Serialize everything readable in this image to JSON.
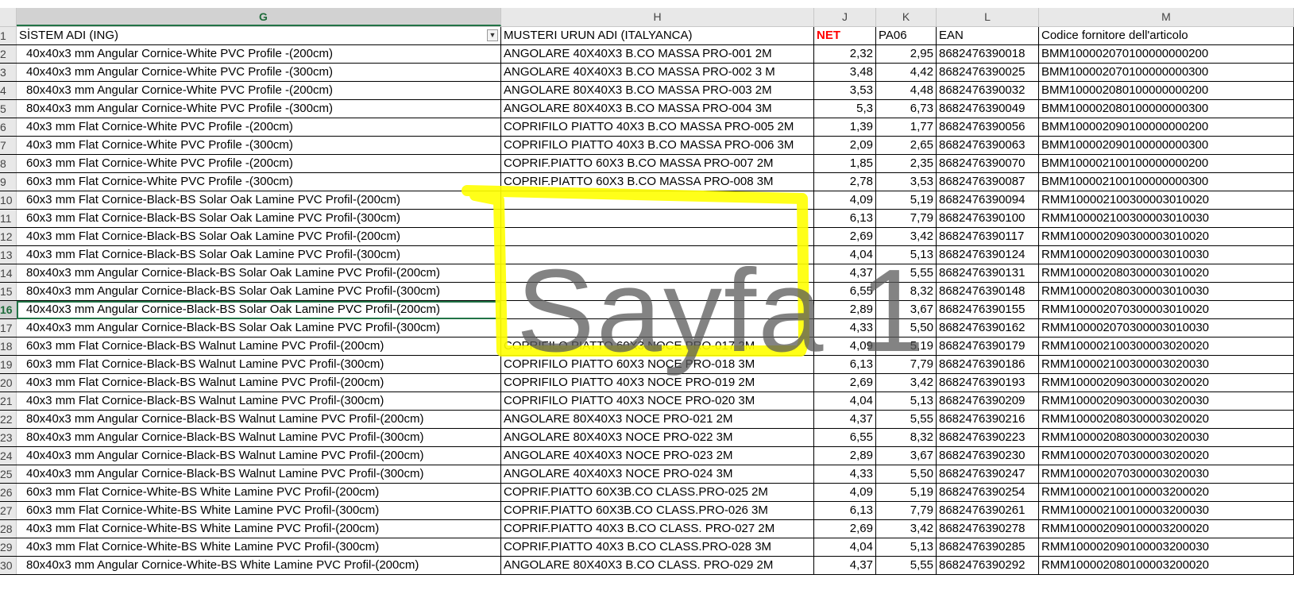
{
  "columns": [
    {
      "letter": "G",
      "selected": true
    },
    {
      "letter": "H",
      "selected": false
    },
    {
      "letter": "J",
      "selected": false
    },
    {
      "letter": "K",
      "selected": false
    },
    {
      "letter": "L",
      "selected": false
    },
    {
      "letter": "M",
      "selected": false
    }
  ],
  "header": {
    "row": "1",
    "g": "SİSTEM ADI (ING)",
    "h": "MUSTERI URUN ADI (ITALYANCA)",
    "j": "NET",
    "k": "PA06",
    "l": "EAN",
    "m": "Codice fornitore dell'articolo"
  },
  "active_row": "16",
  "net_color": "#ff0000",
  "highlight_color": "#ffff00",
  "watermark": "Sayfa 1",
  "rows": [
    {
      "n": "2",
      "g": "40x40x3 mm Angular Cornice-White PVC Profile -(200cm)",
      "h": "ANGOLARE 40X40X3 B.CO MASSA PRO-001 2M",
      "j": "2,32",
      "k": "2,95",
      "l": "8682476390018",
      "m": "BMM100002070100000000200"
    },
    {
      "n": "3",
      "g": "40x40x3 mm Angular Cornice-White PVC Profile -(300cm)",
      "h": "ANGOLARE 40X40X3 B.CO MASSA PRO-002 3 M",
      "j": "3,48",
      "k": "4,42",
      "l": "8682476390025",
      "m": "BMM100002070100000000300"
    },
    {
      "n": "4",
      "g": "80x40x3 mm Angular Cornice-White PVC Profile -(200cm)",
      "h": "ANGOLARE 80X40X3 B.CO MASSA PRO-003 2M",
      "j": "3,53",
      "k": "4,48",
      "l": "8682476390032",
      "m": "BMM100002080100000000200"
    },
    {
      "n": "5",
      "g": "80x40x3 mm Angular Cornice-White PVC Profile -(300cm)",
      "h": "ANGOLARE 80X40X3 B.CO MASSA PRO-004 3M",
      "j": "5,3",
      "k": "6,73",
      "l": "8682476390049",
      "m": "BMM100002080100000000300"
    },
    {
      "n": "6",
      "g": "40x3 mm Flat Cornice-White PVC Profile -(200cm)",
      "h": "COPRIFILO PIATTO 40X3 B.CO MASSA PRO-005 2M",
      "j": "1,39",
      "k": "1,77",
      "l": "8682476390056",
      "m": "BMM100002090100000000200"
    },
    {
      "n": "7",
      "g": "40x3 mm Flat Cornice-White PVC Profile -(300cm)",
      "h": "COPRIFILO PIATTO 40X3 B.CO MASSA PRO-006 3M",
      "j": "2,09",
      "k": "2,65",
      "l": "8682476390063",
      "m": "BMM100002090100000000300"
    },
    {
      "n": "8",
      "g": "60x3 mm Flat Cornice-White PVC Profile -(200cm)",
      "h": "COPRIF.PIATTO 60X3 B.CO MASSA PRO-007 2M",
      "j": "1,85",
      "k": "2,35",
      "l": "8682476390070",
      "m": "BMM100002100100000000200"
    },
    {
      "n": "9",
      "g": "60x3 mm Flat Cornice-White PVC Profile -(300cm)",
      "h": "COPRIF.PIATTO 60X3 B.CO MASSA PRO-008 3M",
      "j": "2,78",
      "k": "3,53",
      "l": "8682476390087",
      "m": "BMM100002100100000000300"
    },
    {
      "n": "10",
      "g": "60x3 mm Flat Cornice-Black-BS  Solar Oak Lamine PVC Profil-(200cm)",
      "h": "",
      "j": "4,09",
      "k": "5,19",
      "l": "8682476390094",
      "m": "RMM100002100300003010020"
    },
    {
      "n": "11",
      "g": "60x3 mm Flat Cornice-Black-BS  Solar Oak Lamine PVC Profil-(300cm)",
      "h": "",
      "j": "6,13",
      "k": "7,79",
      "l": "8682476390100",
      "m": "RMM100002100300003010030"
    },
    {
      "n": "12",
      "g": "40x3 mm Flat Cornice-Black-BS  Solar Oak Lamine PVC Profil-(200cm)",
      "h": "",
      "j": "2,69",
      "k": "3,42",
      "l": "8682476390117",
      "m": "RMM100002090300003010020"
    },
    {
      "n": "13",
      "g": "40x3 mm Flat Cornice-Black-BS  Solar Oak Lamine PVC Profil-(300cm)",
      "h": "",
      "j": "4,04",
      "k": "5,13",
      "l": "8682476390124",
      "m": "RMM100002090300003010030"
    },
    {
      "n": "14",
      "g": "80x40x3 mm Angular Cornice-Black-BS  Solar Oak Lamine PVC Profil-(200cm)",
      "h": "",
      "j": "4,37",
      "k": "5,55",
      "l": "8682476390131",
      "m": "RMM100002080300003010020"
    },
    {
      "n": "15",
      "g": "80x40x3 mm Angular Cornice-Black-BS  Solar Oak Lamine PVC Profil-(300cm)",
      "h": "",
      "j": "6,55",
      "k": "8,32",
      "l": "8682476390148",
      "m": "RMM100002080300003010030"
    },
    {
      "n": "16",
      "g": "40x40x3 mm Angular Cornice-Black-BS  Solar Oak Lamine PVC Profil-(200cm)",
      "h": "",
      "j": "2,89",
      "k": "3,67",
      "l": "8682476390155",
      "m": "RMM100002070300003010020"
    },
    {
      "n": "17",
      "g": "40x40x3 mm Angular Cornice-Black-BS  Solar Oak Lamine PVC Profil-(300cm)",
      "h": "",
      "j": "4,33",
      "k": "5,50",
      "l": "8682476390162",
      "m": "RMM100002070300003010030"
    },
    {
      "n": "18",
      "g": "60x3 mm Flat Cornice-Black-BS  Walnut Lamine PVC Profil-(200cm)",
      "h": "COPRIFILO PIATTO 60X3 NOCE PRO-017 2M",
      "j": "4,09",
      "k": "5,19",
      "l": "8682476390179",
      "m": "RMM100002100300003020020"
    },
    {
      "n": "19",
      "g": "60x3 mm Flat Cornice-Black-BS  Walnut Lamine PVC Profil-(300cm)",
      "h": "COPRIFILO PIATTO 60X3 NOCE PRO-018 3M",
      "j": "6,13",
      "k": "7,79",
      "l": "8682476390186",
      "m": "RMM100002100300003020030"
    },
    {
      "n": "20",
      "g": "40x3 mm Flat Cornice-Black-BS  Walnut Lamine PVC Profil-(200cm)",
      "h": "COPRIFILO PIATTO 40X3 NOCE PRO-019 2M",
      "j": "2,69",
      "k": "3,42",
      "l": "8682476390193",
      "m": "RMM100002090300003020020"
    },
    {
      "n": "21",
      "g": "40x3 mm Flat Cornice-Black-BS  Walnut Lamine PVC Profil-(300cm)",
      "h": "COPRIFILO PIATTO 40X3 NOCE PRO-020 3M",
      "j": "4,04",
      "k": "5,13",
      "l": "8682476390209",
      "m": "RMM100002090300003020030"
    },
    {
      "n": "22",
      "g": "80x40x3 mm Angular Cornice-Black-BS  Walnut Lamine PVC Profil-(200cm)",
      "h": "ANGOLARE 80X40X3 NOCE PRO-021 2M",
      "j": "4,37",
      "k": "5,55",
      "l": "8682476390216",
      "m": "RMM100002080300003020020"
    },
    {
      "n": "23",
      "g": "80x40x3 mm Angular Cornice-Black-BS  Walnut Lamine PVC Profil-(300cm)",
      "h": "ANGOLARE 80X40X3 NOCE PRO-022 3M",
      "j": "6,55",
      "k": "8,32",
      "l": "8682476390223",
      "m": "RMM100002080300003020030"
    },
    {
      "n": "24",
      "g": "40x40x3 mm Angular Cornice-Black-BS  Walnut Lamine PVC Profil-(200cm)",
      "h": "ANGOLARE 40X40X3 NOCE PRO-023 2M",
      "j": "2,89",
      "k": "3,67",
      "l": "8682476390230",
      "m": "RMM100002070300003020020"
    },
    {
      "n": "25",
      "g": "40x40x3 mm Angular Cornice-Black-BS  Walnut Lamine PVC Profil-(300cm)",
      "h": "ANGOLARE 40X40X3 NOCE PRO-024 3M",
      "j": "4,33",
      "k": "5,50",
      "l": "8682476390247",
      "m": "RMM100002070300003020030"
    },
    {
      "n": "26",
      "g": "60x3 mm Flat Cornice-White-BS White Lamine PVC Profil-(200cm)",
      "h": "COPRIF.PIATTO 60X3B.CO CLASS.PRO-025 2M",
      "j": "4,09",
      "k": "5,19",
      "l": "8682476390254",
      "m": "RMM100002100100003200020"
    },
    {
      "n": "27",
      "g": "60x3 mm Flat Cornice-White-BS White Lamine PVC Profil-(300cm)",
      "h": "COPRIF.PIATTO 60X3B.CO CLASS.PRO-026 3M",
      "j": "6,13",
      "k": "7,79",
      "l": "8682476390261",
      "m": "RMM100002100100003200030"
    },
    {
      "n": "28",
      "g": "40x3 mm Flat Cornice-White-BS White Lamine PVC Profil-(200cm)",
      "h": "COPRIF.PIATTO 40X3 B.CO CLASS. PRO-027 2M",
      "j": "2,69",
      "k": "3,42",
      "l": "8682476390278",
      "m": "RMM100002090100003200020"
    },
    {
      "n": "29",
      "g": "40x3 mm Flat Cornice-White-BS White Lamine PVC Profil-(300cm)",
      "h": "COPRIF.PIATTO 40X3 B.CO CLASS.PRO-028 3M",
      "j": "4,04",
      "k": "5,13",
      "l": "8682476390285",
      "m": "RMM100002090100003200030"
    },
    {
      "n": "30",
      "g": "80x40x3 mm Angular Cornice-White-BS White Lamine PVC Profil-(200cm)",
      "h": "ANGOLARE 80X40X3 B.CO CLASS. PRO-029 2M",
      "j": "4,37",
      "k": "5,55",
      "l": "8682476390292",
      "m": "RMM100002080100003200020"
    }
  ]
}
